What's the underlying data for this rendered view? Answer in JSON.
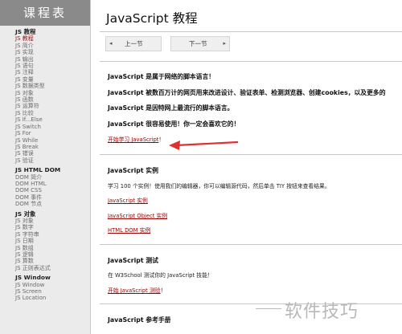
{
  "sidebar": {
    "title": "课程表",
    "sections": [
      {
        "title": "JS 教程",
        "items": [
          "JS 教程",
          "JS 简介",
          "JS 实现",
          "JS 输出",
          "JS 语句",
          "JS 注释",
          "JS 变量",
          "JS 数据类型",
          "JS 对象",
          "JS 函数",
          "JS 运算符",
          "JS 比较",
          "JS If...Else",
          "JS Switch",
          "JS For",
          "JS While",
          "JS Break",
          "JS 错误",
          "JS 验证"
        ]
      },
      {
        "title": "JS HTML DOM",
        "items": [
          "DOM 简介",
          "DOM HTML",
          "DOM CSS",
          "DOM 事件",
          "DOM 节点"
        ]
      },
      {
        "title": "JS 对象",
        "items": [
          "JS 对象",
          "JS 数字",
          "JS 字符串",
          "JS 日期",
          "JS 数组",
          "JS 逻辑",
          "JS 算数",
          "JS 正则表达式"
        ]
      },
      {
        "title": "JS Window",
        "items": [
          "JS Window",
          "JS Screen",
          "JS Location"
        ]
      }
    ],
    "active_item": "JS 教程"
  },
  "main": {
    "page_title": "JavaScript 教程",
    "prev_label": "上一节",
    "next_label": "下一节",
    "intro": [
      "JavaScript 是属于网络的脚本语言！",
      "JavaScript 被数百万计的网页用来改进设计、验证表单、检测浏览器、创建cookies，以及更多的",
      "JavaScript 是因特网上最流行的脚本语言。",
      "JavaScript 很容易使用！你一定会喜欢它的！"
    ],
    "start_link": "开始学习 JavaScript",
    "start_link_suffix": "！",
    "examples": {
      "heading": "JavaScript 实例",
      "text": "学习 100 个实例！使用我们的编辑器，你可以编辑源代码，然后单击 TIY 按钮来查看结果。",
      "links": [
        "JavaScript 实例",
        "JavaScript Object 实例",
        "HTML DOM 实例"
      ]
    },
    "quiz": {
      "heading": "JavaScript 测试",
      "text": "在 W3School 测试你的 JavaScript 技能！",
      "link": "开始 JavaScript 测验",
      "link_suffix": "！"
    },
    "reference": {
      "heading": "JavaScript 参考手册"
    }
  },
  "watermark": "软件技巧",
  "colors": {
    "sidebar_title_bg": "#8a8a8a",
    "link": "#990000",
    "active": "#aa1111",
    "arrow": "#e03030"
  }
}
